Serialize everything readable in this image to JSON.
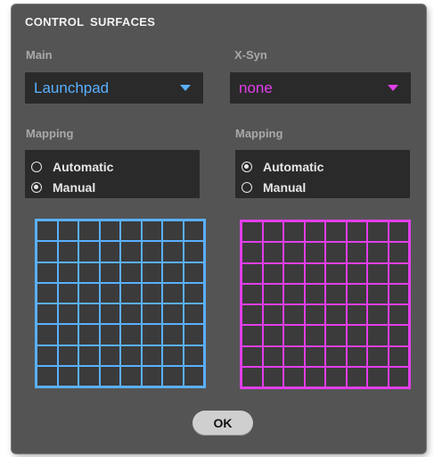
{
  "title": "CONTROL SURFACES",
  "colors": {
    "main_accent": "#5ab0ff",
    "xsyn_accent": "#e13ee9"
  },
  "main": {
    "label": "Main",
    "select_value": "Launchpad",
    "mapping_label": "Mapping",
    "options": [
      "Automatic",
      "Manual"
    ],
    "selected": "Manual"
  },
  "xsyn": {
    "label": "X-Syn",
    "select_value": "none",
    "mapping_label": "Mapping",
    "options": [
      "Automatic",
      "Manual"
    ],
    "selected": "Automatic"
  },
  "grid_size": {
    "cols": 8,
    "rows": 8
  },
  "ok_label": "OK"
}
